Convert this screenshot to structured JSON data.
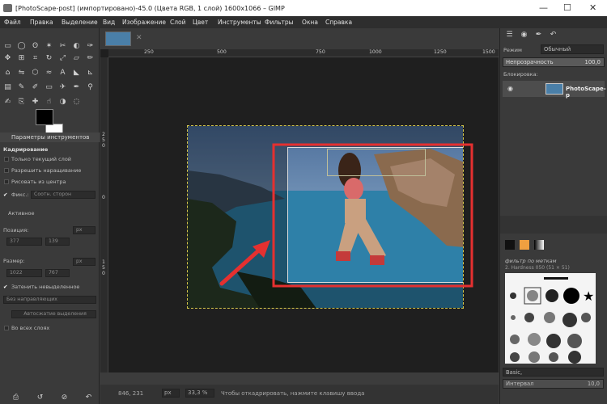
{
  "window": {
    "title": "[PhotoScape-post] (импортировано)-45.0 (Цвета RGB, 1 слой) 1600x1066 – GIMP",
    "minimize": "—",
    "maximize": "☐",
    "close": "✕"
  },
  "menu": [
    "Файл",
    "Правка",
    "Выделение",
    "Вид",
    "Изображение",
    "Слой",
    "Цвет",
    "Инструменты",
    "Фильтры",
    "Окна",
    "Справка"
  ],
  "tool_options": {
    "header": "Параметры инструментов",
    "section": "Кадрирование",
    "current_layer_only": "Только текущий слой",
    "allow_growing": "Разрешить наращивание",
    "expand_from_center": "Рисовать из центра",
    "fixed_label": "Фикс.:",
    "fixed_value": "Соотн. сторон",
    "aspect_value": "Активное",
    "position_label": "Позиция:",
    "position_unit": "px",
    "position_x": "377",
    "position_y": "139",
    "size_label": "Размер:",
    "size_unit": "px",
    "size_w": "1022",
    "size_h": "767",
    "shade_label": "Затенить невыделенное",
    "guides_value": "Без направляющих",
    "autoshrink_label": "Автосжатие выделения",
    "merged_label": "Во всех слоях"
  },
  "ruler": {
    "h": [
      "250",
      "500",
      "750",
      "1000",
      "1250",
      "1500"
    ],
    "v": [
      "2",
      "5",
      "0",
      "0",
      "1",
      "5",
      "0"
    ]
  },
  "status": {
    "coords": "846, 231",
    "unit": "px",
    "zoom": "33,3 %",
    "message": "Чтобы откадрировать, нажмите клавишу ввода"
  },
  "layers": {
    "mode_label": "Режим",
    "mode_value": "Обычный",
    "opacity_label": "Непрозрачность",
    "opacity_value": "100,0",
    "lock_label": "Блокировка:",
    "layer_name": "PhotoScape-p"
  },
  "brushes": {
    "filter_label": "фильтр по меткам",
    "brush_info": "2. Hardness 050 (51 × 51)",
    "preset": "Basic,",
    "spacing_label": "Интервал",
    "spacing_value": "10,0"
  },
  "icons": [
    "rect-select-icon",
    "ellipse-select-icon",
    "free-select-icon",
    "fuzzy-select-icon",
    "scissors-select-icon",
    "fg-select-icon",
    "move-icon",
    "align-icon",
    "crop-icon",
    "rotate-icon",
    "scale-icon",
    "shear-icon",
    "perspective-icon",
    "flip-icon",
    "cage-icon",
    "warp-icon",
    "text-icon",
    "bucket-icon",
    "gradient-icon",
    "pencil-icon",
    "brush-icon",
    "eraser-icon",
    "airbrush-icon",
    "ink-icon",
    "mypaint-icon",
    "clone-icon",
    "heal-icon",
    "smudge-icon",
    "dodge-icon",
    "blur-icon",
    "path-icon",
    "picker-icon",
    "measure-icon",
    "zoom-icon"
  ],
  "colors": {
    "foreground": "#000000",
    "background": "#ffffff",
    "crop_frame": "#e53030",
    "accent_arrow": "#e53030",
    "selection": "#d6c84a",
    "sky": "#7fa6c8",
    "water": "#2e80a8"
  }
}
